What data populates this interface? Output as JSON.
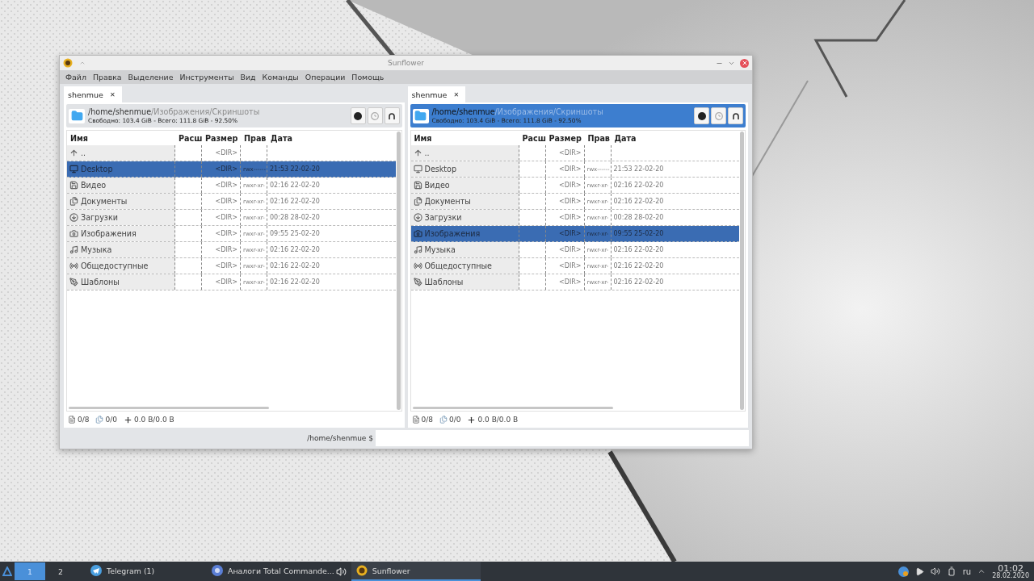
{
  "window": {
    "title": "Sunflower"
  },
  "menu": [
    "Файл",
    "Правка",
    "Выделение",
    "Инструменты",
    "Вид",
    "Команды",
    "Операции",
    "Помощь"
  ],
  "panels": [
    {
      "active": false,
      "tab": {
        "label": "shenmue",
        "close": "✕"
      },
      "path_base": "/home/shenmue",
      "path_rest": "/Изображения/Скриншоты",
      "disk_info": "Свободно: 103.4 GiB - Всего: 111.8 GiB - 92.50%",
      "columns": [
        "Имя",
        "Расш",
        "Размер",
        "Прав",
        "Дата"
      ],
      "rows": [
        {
          "kind": "up",
          "name": "..",
          "size": "<DIR>",
          "perms": "",
          "date": "",
          "selected": false
        },
        {
          "kind": "desktop",
          "name": "Desktop",
          "size": "<DIR>",
          "perms": "rwx------",
          "date": "21:53 22-02-20",
          "selected": true
        },
        {
          "kind": "video",
          "name": "Видео",
          "size": "<DIR>",
          "perms": "rwxr-xr-",
          "date": "02:16 22-02-20",
          "selected": false
        },
        {
          "kind": "documents",
          "name": "Документы",
          "size": "<DIR>",
          "perms": "rwxr-xr-",
          "date": "02:16 22-02-20",
          "selected": false
        },
        {
          "kind": "downloads",
          "name": "Загрузки",
          "size": "<DIR>",
          "perms": "rwxr-xr-",
          "date": "00:28 28-02-20",
          "selected": false
        },
        {
          "kind": "pictures",
          "name": "Изображения",
          "size": "<DIR>",
          "perms": "rwxr-xr-",
          "date": "09:55 25-02-20",
          "selected": false
        },
        {
          "kind": "music",
          "name": "Музыка",
          "size": "<DIR>",
          "perms": "rwxr-xr-",
          "date": "02:16 22-02-20",
          "selected": false
        },
        {
          "kind": "public",
          "name": "Общедоступные",
          "size": "<DIR>",
          "perms": "rwxr-xr-",
          "date": "02:16 22-02-20",
          "selected": false
        },
        {
          "kind": "templates",
          "name": "Шаблоны",
          "size": "<DIR>",
          "perms": "rwxr-xr-",
          "date": "02:16 22-02-20",
          "selected": false
        }
      ],
      "status": {
        "dirs": "0/8",
        "files": "0/0",
        "size": "0.0 B/0.0 B"
      }
    },
    {
      "active": true,
      "tab": {
        "label": "shenmue",
        "close": "✕"
      },
      "path_base": "/home/shenmue",
      "path_rest": "/Изображения/Скриншоты",
      "disk_info": "Свободно: 103.4 GiB - Всего: 111.8 GiB - 92.50%",
      "columns": [
        "Имя",
        "Расш",
        "Размер",
        "Прав",
        "Дата"
      ],
      "rows": [
        {
          "kind": "up",
          "name": "..",
          "size": "<DIR>",
          "perms": "",
          "date": "",
          "selected": false
        },
        {
          "kind": "desktop",
          "name": "Desktop",
          "size": "<DIR>",
          "perms": "rwx------",
          "date": "21:53 22-02-20",
          "selected": false
        },
        {
          "kind": "video",
          "name": "Видео",
          "size": "<DIR>",
          "perms": "rwxr-xr-",
          "date": "02:16 22-02-20",
          "selected": false
        },
        {
          "kind": "documents",
          "name": "Документы",
          "size": "<DIR>",
          "perms": "rwxr-xr-",
          "date": "02:16 22-02-20",
          "selected": false
        },
        {
          "kind": "downloads",
          "name": "Загрузки",
          "size": "<DIR>",
          "perms": "rwxr-xr-",
          "date": "00:28 28-02-20",
          "selected": false
        },
        {
          "kind": "pictures",
          "name": "Изображения",
          "size": "<DIR>",
          "perms": "rwxr-xr-",
          "date": "09:55 25-02-20",
          "selected": true
        },
        {
          "kind": "music",
          "name": "Музыка",
          "size": "<DIR>",
          "perms": "rwxr-xr-",
          "date": "02:16 22-02-20",
          "selected": false
        },
        {
          "kind": "public",
          "name": "Общедоступные",
          "size": "<DIR>",
          "perms": "rwxr-xr-",
          "date": "02:16 22-02-20",
          "selected": false
        },
        {
          "kind": "templates",
          "name": "Шаблоны",
          "size": "<DIR>",
          "perms": "rwxr-xr-",
          "date": "02:16 22-02-20",
          "selected": false
        }
      ],
      "status": {
        "dirs": "0/8",
        "files": "0/0",
        "size": "0.0 B/0.0 B"
      }
    }
  ],
  "command": {
    "prompt": "/home/shenmue $"
  },
  "taskbar": {
    "workspaces": [
      {
        "label": "1",
        "selected": true
      },
      {
        "label": "2",
        "selected": false
      }
    ],
    "tasks": [
      {
        "kind": "telegram",
        "label": "Telegram (1)",
        "active": false
      },
      {
        "kind": "browser",
        "label": "Аналоги Total Commande...",
        "active": false
      },
      {
        "kind": "sunflower",
        "label": "Sunflower",
        "active": true
      }
    ],
    "language": "ru",
    "time": "01:02",
    "date": "28.02.2020"
  }
}
